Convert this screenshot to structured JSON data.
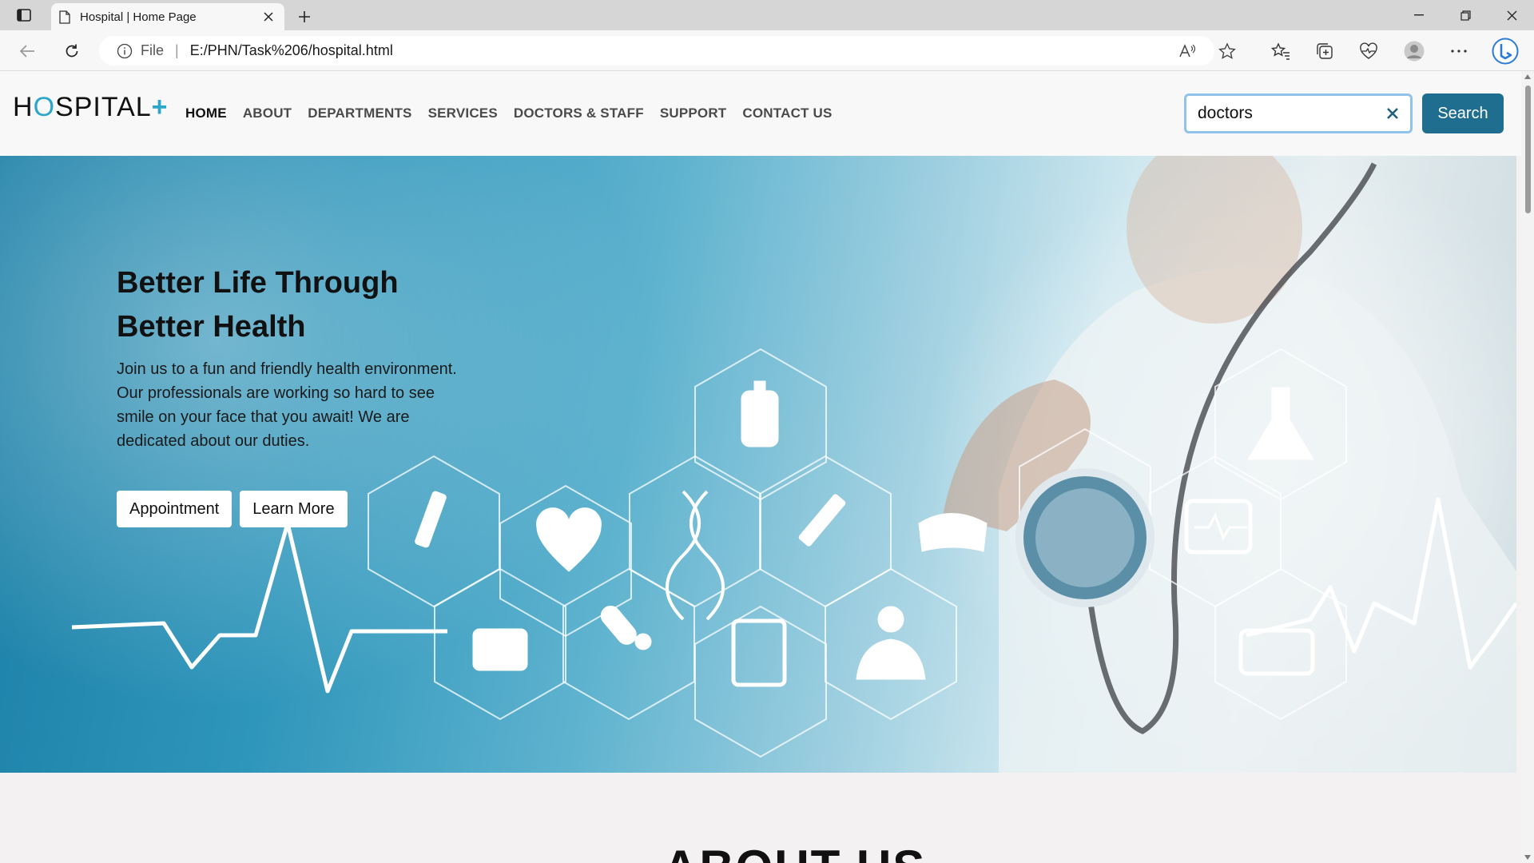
{
  "browser": {
    "tab_title": "Hospital | Home Page",
    "url_prefix": "File",
    "url": "E:/PHN/Task%206/hospital.html"
  },
  "header": {
    "logo_part1": "H",
    "logo_o": "O",
    "logo_part2": "SPITAL",
    "logo_plus": "+",
    "nav": [
      "HOME",
      "ABOUT",
      "DEPARTMENTS",
      "SERVICES",
      "DOCTORS & STAFF",
      "SUPPORT",
      "CONTACT US"
    ],
    "search_value": "doctors",
    "search_button": "Search"
  },
  "hero": {
    "title_line1": "Better Life Through",
    "title_line2": "Better Health",
    "description": "Join us to a fun and friendly health environment. Our professionals are working so hard to see smile on your face that you await! We are dedicated about our duties.",
    "button_appointment": "Appointment",
    "button_learn_more": "Learn More"
  },
  "next_section_title": "ABOUT US",
  "colors": {
    "accent": "#2ba5c9",
    "search_button": "#1f6d8f"
  }
}
